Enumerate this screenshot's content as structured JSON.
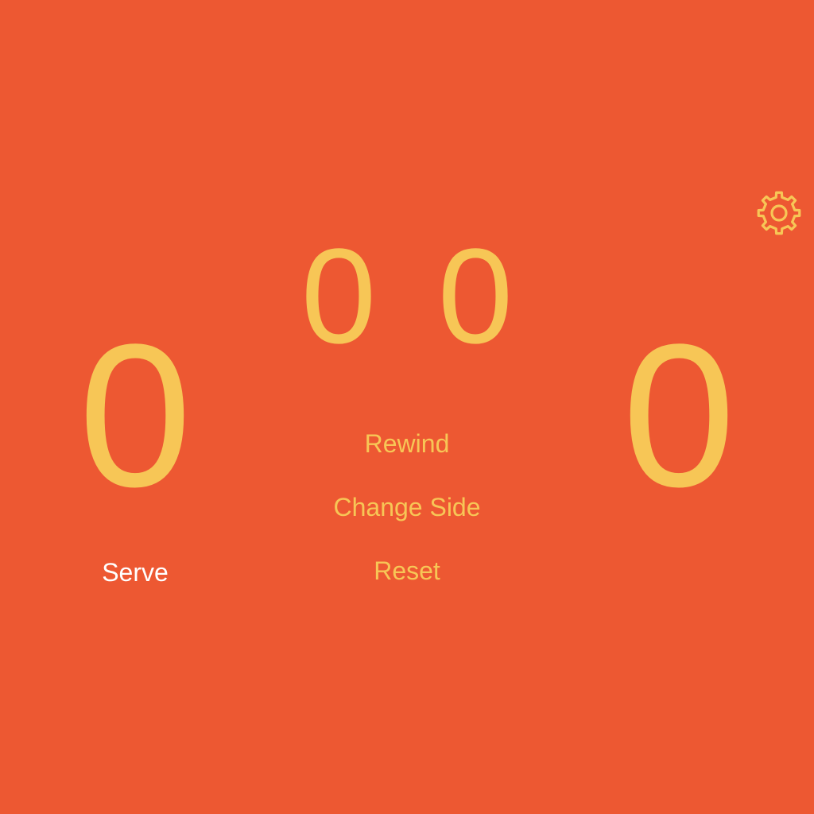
{
  "scoreboard": {
    "left_points": "0",
    "right_points": "0",
    "left_games": "0",
    "right_games": "0"
  },
  "actions": {
    "rewind_label": "Rewind",
    "change_side_label": "Change Side",
    "reset_label": "Reset"
  },
  "serve_indicator": {
    "label": "Serve"
  },
  "toolbar": {
    "settings_icon": "gear-icon"
  },
  "colors": {
    "background": "#ED5832",
    "accent": "#F7C656",
    "serve_text": "#FFFFFF"
  }
}
